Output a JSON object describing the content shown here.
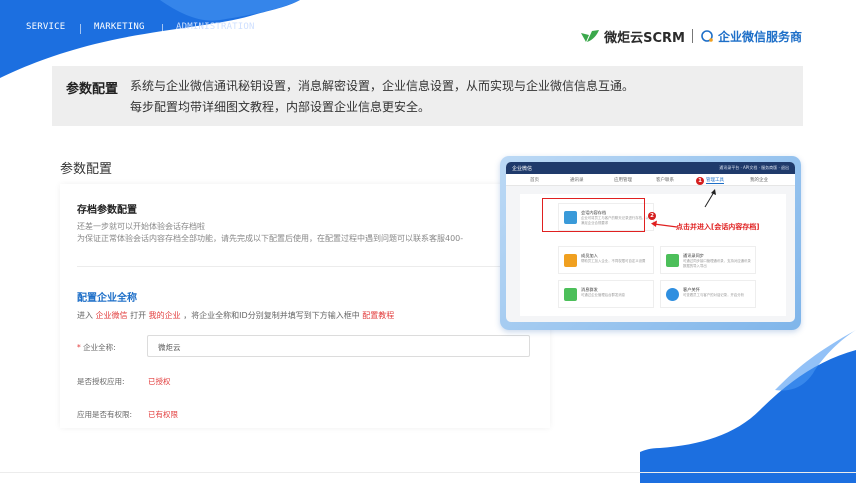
{
  "nav": {
    "items": [
      {
        "label": "SERVICE"
      },
      {
        "label": "MARKETING"
      },
      {
        "label": "ADMINISTRATION"
      }
    ]
  },
  "brand": {
    "name": "微炬云SCRM",
    "tagline": "企业微信服务商",
    "accent_color": "#1e6fc8",
    "leaf_color": "#3aa84b",
    "icon": "leaf-logo-icon"
  },
  "intro": {
    "label": "参数配置",
    "line1": "系统与企业微信通讯秘钥设置，消息解密设置，企业信息设置，从而实现与企业微信信息互通。",
    "line2": "每步配置均带详细图文教程，内部设置企业信息更安全。"
  },
  "settings": {
    "page_title": "参数配置",
    "archive": {
      "title": "存档参数配置",
      "line1": "还差一步就可以开始体验会话存档啦",
      "line2": "为保证正常体验会话内容存档全部功能，请先完成以下配置后使用，在配置过程中遇到问题可以联系客服400-"
    },
    "company": {
      "title": "配置企业全称",
      "desc_prefix": "进入",
      "desc_link1": "企业微信",
      "desc_mid1": "打开",
      "desc_link2": "我的企业",
      "desc_mid2": "，将企业全称和ID分别复制并填写到下方输入框中",
      "desc_link3": "配置教程",
      "name_label": "企业全称:",
      "name_value": "微炬云",
      "auth_label": "是否授权应用:",
      "auth_value": "已授权",
      "perm_label": "应用是否有权限:",
      "perm_value": "已有权限"
    }
  },
  "screenshot": {
    "logo": "企业微信",
    "top_right": "通讯录平台 · API文档 · 服务商版 · 退出",
    "tabs": [
      "首页",
      "通讯录",
      "应用管理",
      "客户联系",
      "管理工具",
      "我的企业"
    ],
    "active_tab": "管理工具",
    "step1": "1",
    "step2": "2",
    "callout": "点击并进入[会话内容存档]",
    "cards": [
      {
        "title": "会话内容存档",
        "desc": "企业可将员工与客户的聊天记录进行存档，以满足企业合规要求",
        "icon": "archive-icon",
        "color": "#3a9ad9"
      },
      {
        "title": "成员加入",
        "desc": "帮助员工加入企业，不同权限可自定义设置",
        "icon": "member-icon",
        "color": "#f0a020"
      },
      {
        "title": "通讯录同步",
        "desc": "可通过同步接口管理通讯录，支持对应通讯录数据的导入导出",
        "icon": "sync-icon",
        "color": "#4cbf5a"
      },
      {
        "title": "消息群发",
        "desc": "可通过企业管理后台群发消息",
        "icon": "broadcast-icon",
        "color": "#4cbf5a"
      },
      {
        "title": "客户关怀",
        "desc": "可查看员工与客户的对话记录，开启分析",
        "icon": "chat-icon",
        "color": "#2f8fe0"
      }
    ]
  }
}
